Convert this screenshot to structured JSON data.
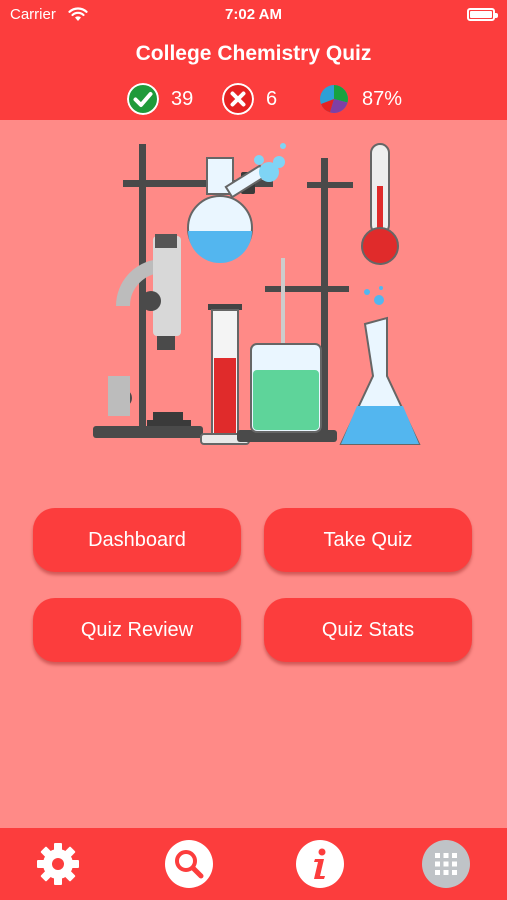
{
  "status_bar": {
    "carrier": "Carrier",
    "time": "7:02 AM"
  },
  "header": {
    "title": "College Chemistry Quiz",
    "stats": {
      "correct": "39",
      "incorrect": "6",
      "score": "87%"
    }
  },
  "menu": {
    "dashboard": "Dashboard",
    "take_quiz": "Take Quiz",
    "quiz_review": "Quiz Review",
    "quiz_stats": "Quiz Stats"
  },
  "tab_bar": {
    "icons": [
      "gear-icon",
      "search-icon",
      "info-icon",
      "grid-icon"
    ]
  },
  "colors": {
    "header": "#fc3d3d",
    "background": "#ff8a87",
    "button": "#fc3d3d",
    "correct": "#1f9a3a",
    "incorrect": "#e52222"
  }
}
